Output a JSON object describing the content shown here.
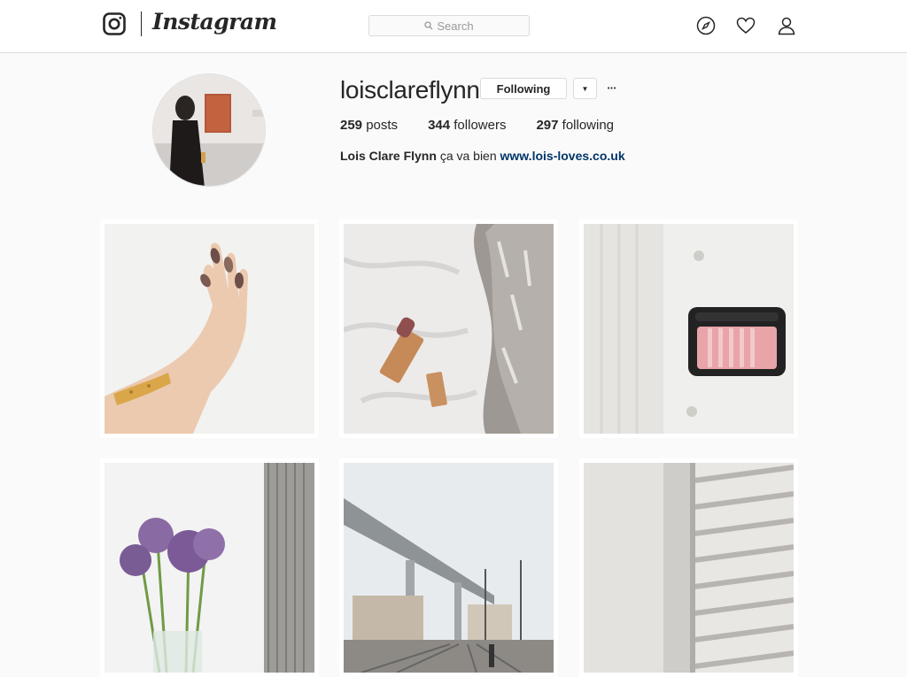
{
  "header": {
    "brand": "Instagram",
    "search_placeholder": "Search",
    "icons": [
      "instagram-glyph-icon",
      "search-icon",
      "compass-icon",
      "heart-icon",
      "person-icon"
    ]
  },
  "profile": {
    "username": "loisclareflynn",
    "follow_label": "Following",
    "dropdown_glyph": "▼",
    "more_glyph": "•••",
    "stats": [
      {
        "count": "259",
        "label": "posts"
      },
      {
        "count": "344",
        "label": "followers"
      },
      {
        "count": "297",
        "label": "following"
      }
    ],
    "bio_name": "Lois Clare Flynn",
    "bio_text": "ça va bien",
    "bio_link": "www.lois-loves.co.uk"
  },
  "posts": [
    {
      "subject": "hand with painted nails and gold bracelet"
    },
    {
      "subject": "lipstick on white sheets with fur"
    },
    {
      "subject": "pink blush compact on white linen"
    },
    {
      "subject": "purple allium flowers in vase"
    },
    {
      "subject": "elevated highway over railway tracks"
    },
    {
      "subject": "white wooden shutters"
    }
  ],
  "colors": {
    "background": "#fafafa",
    "text": "#262626",
    "link": "#003569",
    "border": "#dbdbdb"
  }
}
